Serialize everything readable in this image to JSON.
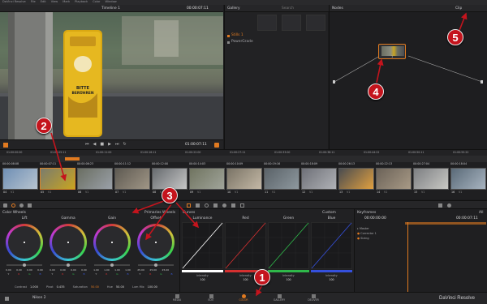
{
  "app": {
    "menubar": [
      "DaVinci Resolve",
      "File",
      "Edit",
      "View",
      "Mark",
      "Playback",
      "Color",
      "Window"
    ],
    "brand": "DaVinci Resolve"
  },
  "viewer": {
    "timeline_label": "Timeline 1",
    "timecode_top": "00:00:07:11",
    "timecode_bottom": "01:00:07:11",
    "sign": "BITTE\nBERÜHREN"
  },
  "gallery": {
    "title": "Gallery",
    "search_placeholder": "Search",
    "items": [
      "Stills 1",
      "PowerGrade"
    ]
  },
  "nodes": {
    "title": "Nodes",
    "mode": "Clip",
    "node_label": "1"
  },
  "ruler": {
    "labels": [
      "01:00:00:00",
      "01:00:05:11",
      "01:00:11:00",
      "01:00:16:11",
      "01:00:22:00",
      "01:00:27:11",
      "01:00:33:00",
      "01:00:38:11",
      "01:00:44:22",
      "01:00:50:11",
      "01:00:55:22"
    ]
  },
  "clips": [
    {
      "tc": "00:00:08:08",
      "num": "04",
      "tr": "V1"
    },
    {
      "tc": "00:00:07:11",
      "num": "05",
      "tr": "V1"
    },
    {
      "tc": "00:00:06:23",
      "num": "06",
      "tr": "V1"
    },
    {
      "tc": "00:00:11:12",
      "num": "07",
      "tr": "V1"
    },
    {
      "tc": "00:00:12:00",
      "num": "08",
      "tr": "V1"
    },
    {
      "tc": "00:00:14:03",
      "num": "09",
      "tr": "V1"
    },
    {
      "tc": "00:00:10:09",
      "num": "10",
      "tr": "V1"
    },
    {
      "tc": "00:00:19:16",
      "num": "11",
      "tr": "V1"
    },
    {
      "tc": "00:00:18:09",
      "num": "12",
      "tr": "V1"
    },
    {
      "tc": "00:00:26:13",
      "num": "13",
      "tr": "V1"
    },
    {
      "tc": "00:00:22:13",
      "num": "14",
      "tr": "V1"
    },
    {
      "tc": "00:00:27:04",
      "num": "15",
      "tr": "V1"
    },
    {
      "tc": "00:00:18:04",
      "num": "16",
      "tr": "V1"
    }
  ],
  "color_wheels": {
    "title": "Color Wheels",
    "mode": "Primaries Wheels",
    "wheels": [
      {
        "name": "Lift",
        "values": [
          "0.00",
          "0.00",
          "0.00",
          "0.00"
        ]
      },
      {
        "name": "Gamma",
        "values": [
          "0.00",
          "0.00",
          "0.00",
          "0.00"
        ]
      },
      {
        "name": "Gain",
        "values": [
          "1.00",
          "1.00",
          "1.00",
          "1.00"
        ]
      },
      {
        "name": "Offset",
        "values": [
          "25.00",
          "25.00",
          "25.00",
          ""
        ]
      }
    ],
    "channel_labels": [
      "Y",
      "R",
      "G",
      "B"
    ],
    "footer": {
      "contrast_label": "Contrast",
      "contrast": "1.000",
      "pivot_label": "Pivot",
      "pivot": "0.435",
      "sat_label": "Saturation",
      "sat": "50.00",
      "hue_label": "Hue",
      "hue": "50.00",
      "lummix_label": "Lum Mix",
      "lummix": "100.00"
    }
  },
  "curves": {
    "title": "Curves",
    "channels": [
      {
        "name": "Luminance",
        "intensity_label": "Intensity",
        "intensity": "100",
        "color": "#ffffff"
      },
      {
        "name": "Red",
        "intensity_label": "Intensity",
        "intensity": "100",
        "color": "#d53030"
      },
      {
        "name": "Green",
        "intensity_label": "Intensity",
        "intensity": "100",
        "color": "#2fb84a"
      },
      {
        "name": "Blue",
        "intensity_label": "Intensity",
        "intensity": "100",
        "color": "#3550dd"
      }
    ],
    "custom_label": "Custom"
  },
  "keyframes": {
    "title": "Keyframes",
    "scope": "All",
    "tc_left": "00:00:00:00",
    "tc_right": "00:00:07:11",
    "tracks": [
      "Master",
      "Corrector 1",
      "Sizing"
    ]
  },
  "bottom": {
    "project": "Nikon 2",
    "tabs": [
      "MEDIA",
      "EDIT",
      "COLOR",
      "GALLERY",
      "DELIVER"
    ],
    "active_tab": "COLOR"
  },
  "callouts": [
    "1",
    "2",
    "3",
    "4",
    "5"
  ],
  "colors": {
    "accent": "#e07a20",
    "badge": "#c4141d"
  }
}
